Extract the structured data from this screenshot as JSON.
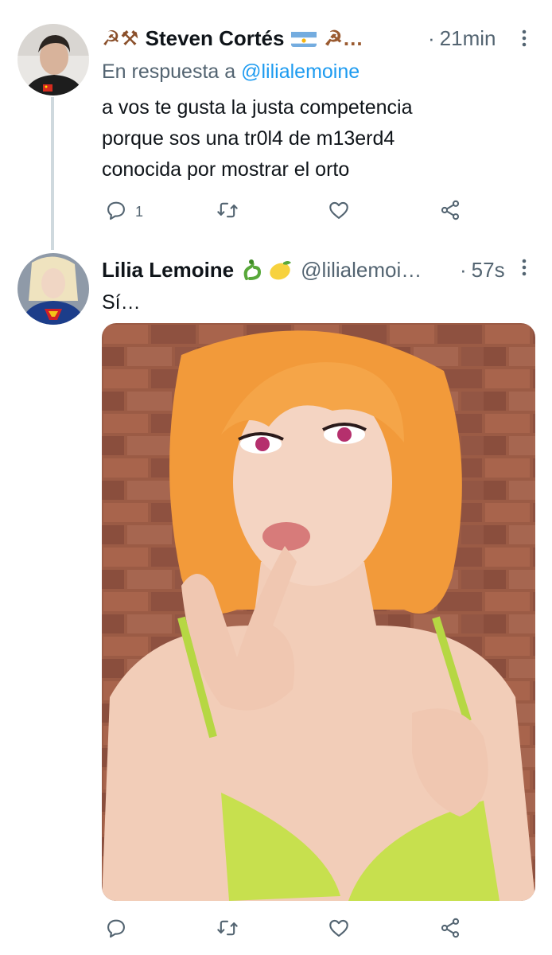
{
  "tweet1": {
    "name_prefix_emoji": "☭⚒",
    "display_name": "Steven Cortés",
    "name_suffix": "☭…",
    "separator": "·",
    "time": "21min",
    "reply_prefix": "En respuesta a",
    "reply_mention": "@lilialemoine",
    "text_lines": [
      "a vos te gusta la justa competencia",
      "porque sos una tr0l4 de m13erd4",
      "conocida por mostrar el orto"
    ],
    "reply_count": "1"
  },
  "tweet2": {
    "display_name": "Lilia Lemoine",
    "handle": "@lilialemoi…",
    "separator": "·",
    "time": "57s",
    "text": "Sí…"
  },
  "icons": {
    "reply": "reply-icon",
    "retweet": "retweet-icon",
    "like": "heart-icon",
    "share": "share-icon",
    "more": "more-options-icon"
  },
  "colors": {
    "text": "#0f1419",
    "secondary": "#536471",
    "link": "#1d9bf0",
    "thread_line": "#cfd9de"
  }
}
